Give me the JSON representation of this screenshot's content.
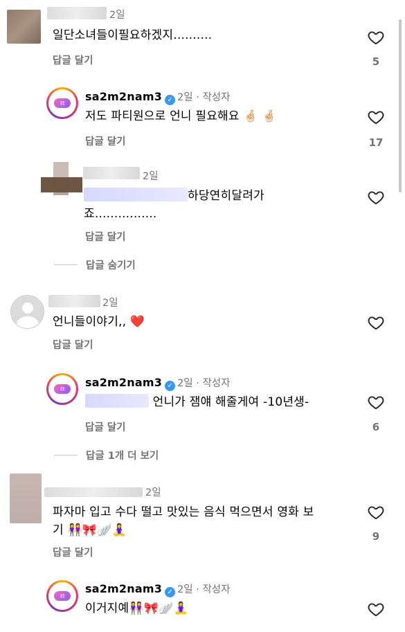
{
  "comments": [
    {
      "time": "2일",
      "text": "일단소녀들이필요하겠지..........",
      "reply": "답글 달기",
      "likes": "5"
    },
    {
      "username": "sa2m2nam3",
      "time": "2일",
      "author": "작성자",
      "text": "저도 파티원으로 언니 필요해요 🤞🏻 🤞🏻",
      "reply": "답글 달기",
      "likes": "17"
    },
    {
      "time": "2일",
      "text_line1": "하당연히달려가",
      "text_line2": "죠................",
      "reply": "답글 달기"
    },
    {
      "hide_replies": "답글 숨기기"
    },
    {
      "time": "2일",
      "text": "언니들이야기,, ❤️",
      "reply": "답글 달기"
    },
    {
      "username": "sa2m2nam3",
      "time": "2일",
      "author": "작성자",
      "text": "언니가 잼얘 해줄게여 -10년생-",
      "reply": "답글 달기",
      "likes": "6"
    },
    {
      "view_more": "답글 1개 더 보기"
    },
    {
      "time": "2일",
      "text_line1": "파자마 입고 수다 떨고 맛있는 음식 먹으면서 영화 보",
      "text_line2": "기 👭🎀🪽🧘‍♀️",
      "reply": "답글 달기",
      "likes": "9"
    },
    {
      "username": "sa2m2nam3",
      "time": "2일",
      "author": "작성자",
      "text": "이거지예👭🎀🪽🧘‍♀️"
    }
  ],
  "badge_text": "ﾐﾐ",
  "icons": {
    "heart": "heart-outline-icon",
    "verified": "verified-badge-icon",
    "avatar_default": "default-avatar-icon"
  },
  "colors": {
    "verified": "#3897f0",
    "muted": "#737373"
  }
}
